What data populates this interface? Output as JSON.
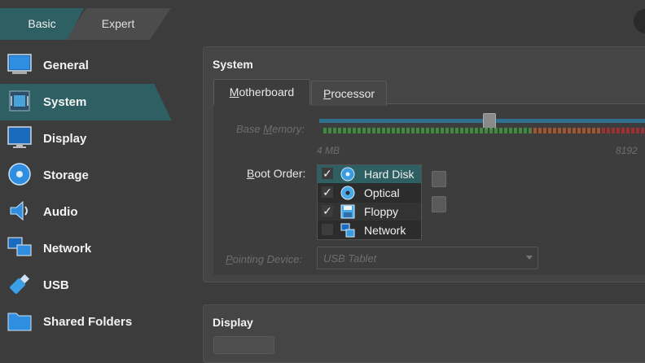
{
  "mode_tabs": {
    "basic": "Basic",
    "expert": "Expert"
  },
  "sidebar": {
    "items": [
      {
        "label": "General",
        "icon": "general-icon"
      },
      {
        "label": "System",
        "icon": "chip-icon",
        "selected": true
      },
      {
        "label": "Display",
        "icon": "monitor-icon"
      },
      {
        "label": "Storage",
        "icon": "disk-icon"
      },
      {
        "label": "Audio",
        "icon": "speaker-icon"
      },
      {
        "label": "Network",
        "icon": "network-icon"
      },
      {
        "label": "USB",
        "icon": "usb-icon"
      },
      {
        "label": "Shared Folders",
        "icon": "folder-icon"
      }
    ]
  },
  "system": {
    "title": "System",
    "tabs": {
      "motherboard_pre": "",
      "motherboard_ul": "M",
      "motherboard_post": "otherboard",
      "processor_pre": "",
      "processor_ul": "P",
      "processor_post": "rocessor"
    },
    "base_memory": {
      "label_pre": "Base ",
      "label_ul": "M",
      "label_post": "emory:",
      "min_label": "4 MB",
      "max_label": "8192"
    },
    "boot_order": {
      "label_pre": "",
      "label_ul": "B",
      "label_post": "oot Order:",
      "devices": [
        {
          "label": "Hard Disk",
          "checked": "✓",
          "icon": "hard-disk-icon"
        },
        {
          "label": "Optical",
          "checked": "✓",
          "icon": "optical-disc-icon"
        },
        {
          "label": "Floppy",
          "checked": "✓",
          "icon": "floppy-icon"
        },
        {
          "label": "Network",
          "checked": "",
          "icon": "network-boot-icon"
        }
      ]
    },
    "pointing_device": {
      "label_pre": "",
      "label_ul": "P",
      "label_post": "ointing Device:",
      "value": "USB Tablet"
    }
  },
  "display_section": {
    "title": "Display"
  },
  "colors": {
    "accent": "#2d5f63",
    "panel": "#454545",
    "background": "#3c3c3c"
  }
}
